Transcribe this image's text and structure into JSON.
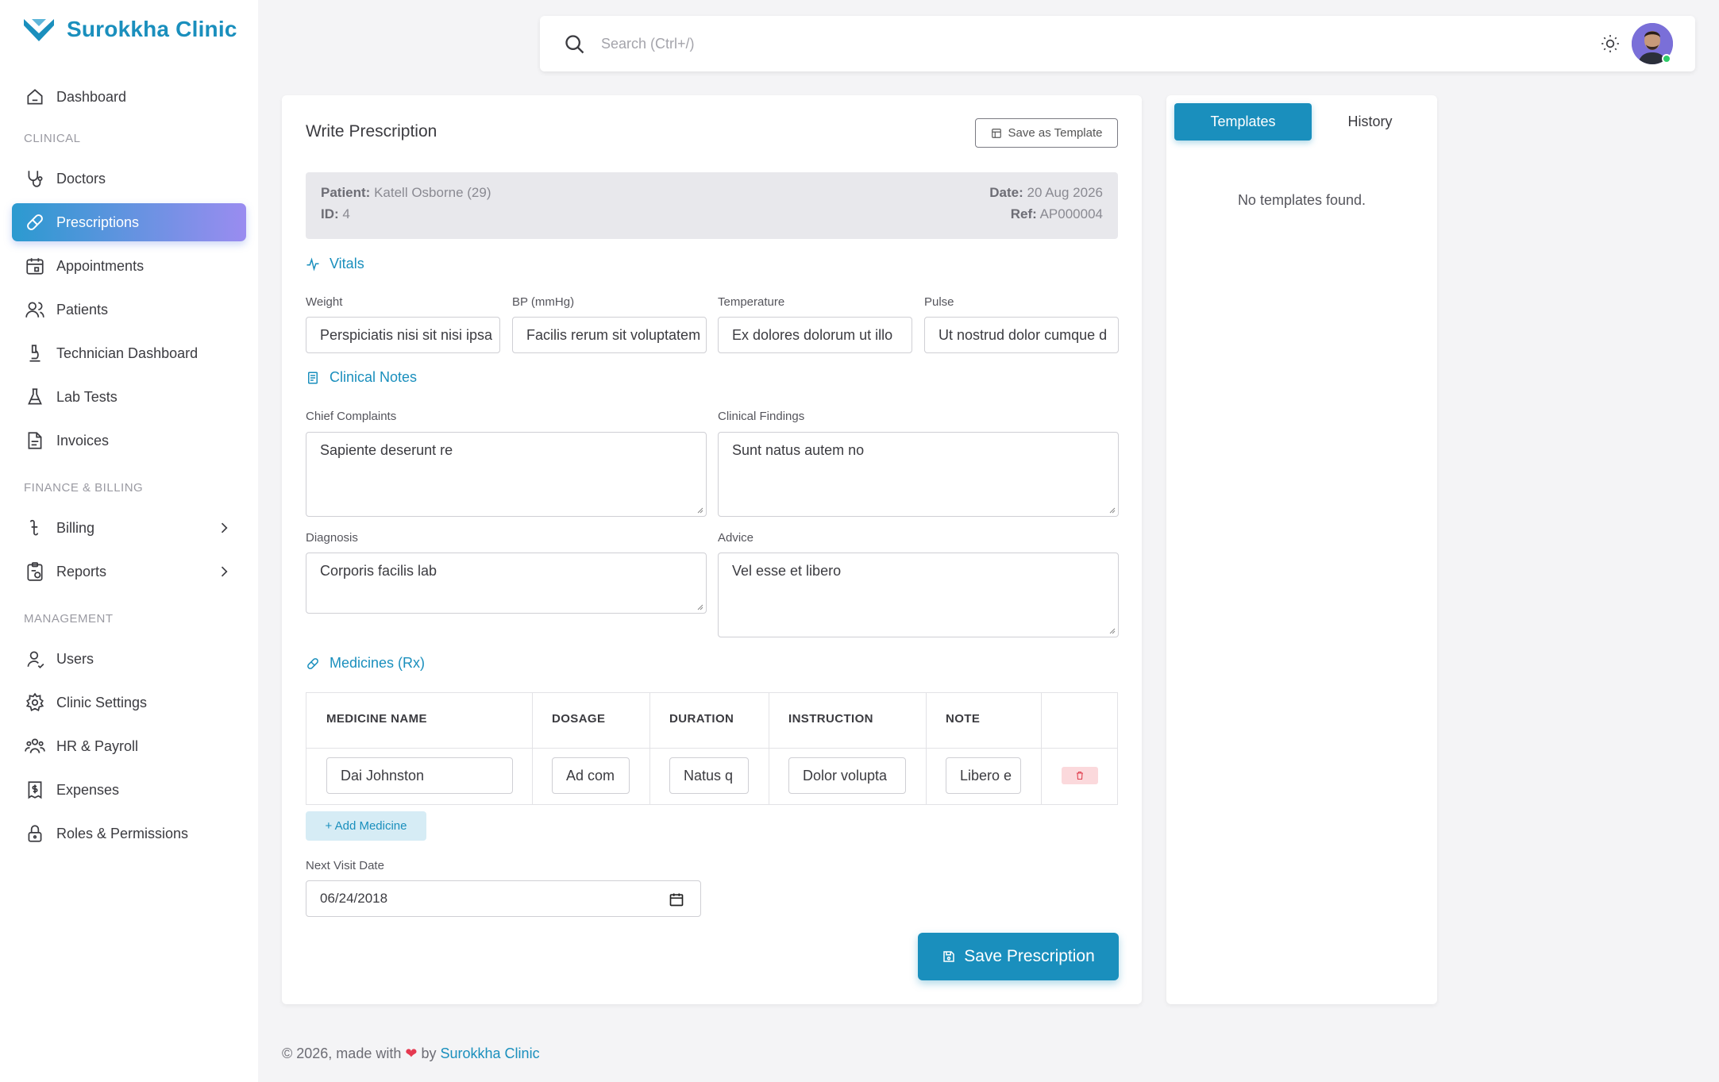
{
  "app": {
    "brand": "Surokkha Clinic"
  },
  "sidebar": {
    "sections": {
      "clinical": "CLINICAL",
      "finance": "FINANCE & BILLING",
      "management": "MANAGEMENT"
    },
    "items": [
      {
        "label": "Dashboard"
      },
      {
        "label": "Doctors"
      },
      {
        "label": "Prescriptions"
      },
      {
        "label": "Appointments"
      },
      {
        "label": "Patients"
      },
      {
        "label": "Technician Dashboard"
      },
      {
        "label": "Lab Tests"
      },
      {
        "label": "Invoices"
      },
      {
        "label": "Billing"
      },
      {
        "label": "Reports"
      },
      {
        "label": "Users"
      },
      {
        "label": "Clinic Settings"
      },
      {
        "label": "HR & Payroll"
      },
      {
        "label": "Expenses"
      },
      {
        "label": "Roles & Permissions"
      }
    ]
  },
  "search": {
    "placeholder": "Search (Ctrl+/)"
  },
  "prescription": {
    "title": "Write Prescription",
    "save_template_label": "Save as Template",
    "patient": {
      "patient_label": "Patient:",
      "patient_value": "Katell Osborne (29)",
      "id_label": "ID:",
      "id_value": "4",
      "date_label": "Date:",
      "date_value": "20 Aug 2026",
      "ref_label": "Ref:",
      "ref_value": "AP000004"
    },
    "vitals": {
      "heading": "Vitals",
      "weight_label": "Weight",
      "weight_value": "Perspiciatis nisi sit nisi ipsa",
      "bp_label": "BP (mmHg)",
      "bp_value": "Facilis rerum sit voluptatem",
      "temp_label": "Temperature",
      "temp_value": "Ex dolores dolorum ut illo",
      "pulse_label": "Pulse",
      "pulse_value": "Ut nostrud dolor cumque d"
    },
    "notes": {
      "heading": "Clinical Notes",
      "complaints_label": "Chief Complaints",
      "complaints_value": "Sapiente deserunt re",
      "findings_label": "Clinical Findings",
      "findings_value": "Sunt natus autem no",
      "diagnosis_label": "Diagnosis",
      "diagnosis_value": "Corporis facilis lab",
      "advice_label": "Advice",
      "advice_value": "Vel esse et libero"
    },
    "medicines": {
      "heading": "Medicines (Rx)",
      "columns": [
        "MEDICINE NAME",
        "DOSAGE",
        "DURATION",
        "INSTRUCTION",
        "NOTE"
      ],
      "rows": [
        {
          "name": "Dai Johnston",
          "dosage": "Ad com",
          "duration": "Natus q",
          "instruction": "Dolor volupta",
          "note": "Libero e"
        }
      ],
      "add_label": "+ Add Medicine"
    },
    "next_visit": {
      "label": "Next Visit Date",
      "value": "06/24/2018"
    },
    "save_label": "Save Prescription"
  },
  "side_panel": {
    "tabs": [
      "Templates",
      "History"
    ],
    "empty_text": "No templates found."
  },
  "footer": {
    "prefix": "© 2026, made with",
    "by": "by",
    "link": "Surokkha Clinic"
  },
  "colors": {
    "accent": "#1a8fbd",
    "active_gradient_end": "#9a8cf0",
    "danger_bg": "#fbd9dc"
  }
}
